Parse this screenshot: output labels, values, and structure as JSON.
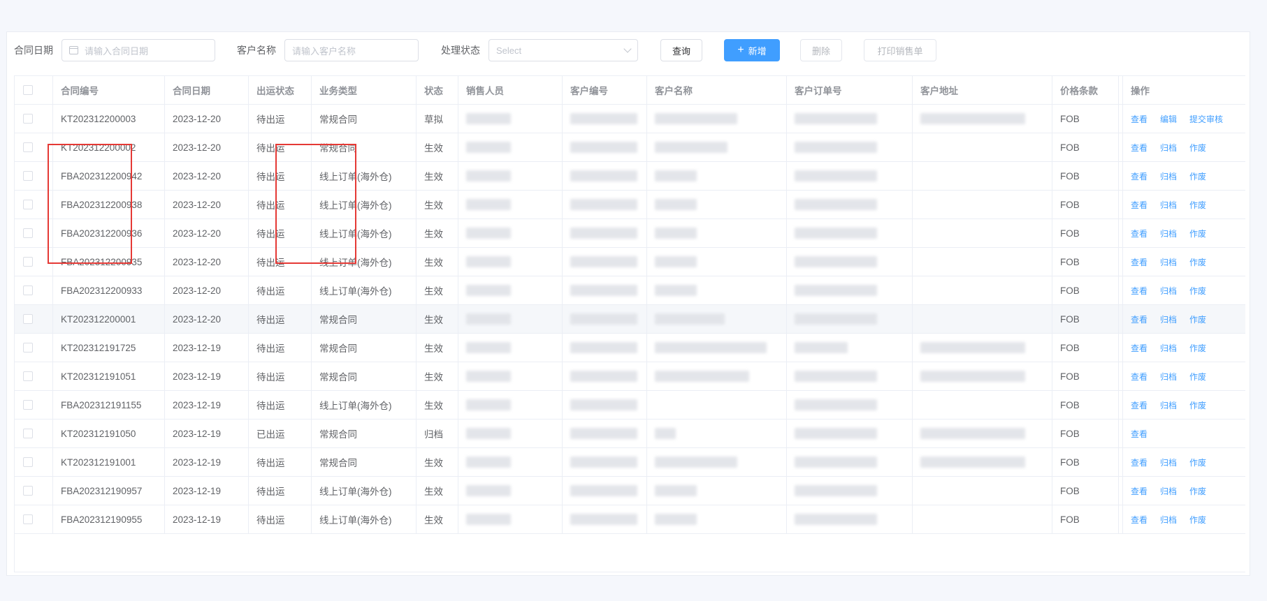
{
  "filters": {
    "contract_date_label": "合同日期",
    "contract_date_placeholder": "请输入合同日期",
    "customer_name_label": "客户名称",
    "customer_name_placeholder": "请输入客户名称",
    "status_label": "处理状态",
    "status_placeholder": "Select"
  },
  "toolbar": {
    "query": "查询",
    "add": "新增",
    "delete": "删除",
    "print_sales": "打印销售单"
  },
  "columns": [
    "合同编号",
    "合同日期",
    "出运状态",
    "业务类型",
    "状态",
    "销售人员",
    "客户编号",
    "客户名称",
    "客户订单号",
    "客户地址",
    "价格条款",
    "操作"
  ],
  "rows": [
    {
      "no": "KT202312200003",
      "date": "2023-12-20",
      "ship": "待出运",
      "type": "常规合同",
      "status": "草拟",
      "price": "FOB",
      "ops": [
        "查看",
        "编辑",
        "提交审核"
      ]
    },
    {
      "no": "KT202312200002",
      "date": "2023-12-20",
      "ship": "待出运",
      "type": "常规合同",
      "status": "生效",
      "price": "FOB",
      "ops": [
        "查看",
        "归档",
        "作废"
      ]
    },
    {
      "no": "FBA202312200942",
      "date": "2023-12-20",
      "ship": "待出运",
      "type": "线上订单(海外仓)",
      "status": "生效",
      "price": "FOB",
      "ops": [
        "查看",
        "归档",
        "作废"
      ]
    },
    {
      "no": "FBA202312200938",
      "date": "2023-12-20",
      "ship": "待出运",
      "type": "线上订单(海外仓)",
      "status": "生效",
      "price": "FOB",
      "ops": [
        "查看",
        "归档",
        "作废"
      ]
    },
    {
      "no": "FBA202312200936",
      "date": "2023-12-20",
      "ship": "待出运",
      "type": "线上订单(海外仓)",
      "status": "生效",
      "price": "FOB",
      "ops": [
        "查看",
        "归档",
        "作废"
      ]
    },
    {
      "no": "FBA202312200935",
      "date": "2023-12-20",
      "ship": "待出运",
      "type": "线上订单(海外仓)",
      "status": "生效",
      "price": "FOB",
      "ops": [
        "查看",
        "归档",
        "作废"
      ]
    },
    {
      "no": "FBA202312200933",
      "date": "2023-12-20",
      "ship": "待出运",
      "type": "线上订单(海外仓)",
      "status": "生效",
      "price": "FOB",
      "ops": [
        "查看",
        "归档",
        "作废"
      ]
    },
    {
      "no": "KT202312200001",
      "date": "2023-12-20",
      "ship": "待出运",
      "type": "常规合同",
      "status": "生效",
      "price": "FOB",
      "ops": [
        "查看",
        "归档",
        "作废"
      ]
    },
    {
      "no": "KT202312191725",
      "date": "2023-12-19",
      "ship": "待出运",
      "type": "常规合同",
      "status": "生效",
      "price": "FOB",
      "ops": [
        "查看",
        "归档",
        "作废"
      ]
    },
    {
      "no": "KT202312191051",
      "date": "2023-12-19",
      "ship": "待出运",
      "type": "常规合同",
      "status": "生效",
      "price": "FOB",
      "ops": [
        "查看",
        "归档",
        "作废"
      ]
    },
    {
      "no": "FBA202312191155",
      "date": "2023-12-19",
      "ship": "待出运",
      "type": "线上订单(海外仓)",
      "status": "生效",
      "price": "FOB",
      "ops": [
        "查看",
        "归档",
        "作废"
      ]
    },
    {
      "no": "KT202312191050",
      "date": "2023-12-19",
      "ship": "已出运",
      "type": "常规合同",
      "status": "归档",
      "price": "FOB",
      "ops": [
        "查看"
      ]
    },
    {
      "no": "KT202312191001",
      "date": "2023-12-19",
      "ship": "待出运",
      "type": "常规合同",
      "status": "生效",
      "price": "FOB",
      "ops": [
        "查看",
        "归档",
        "作废"
      ]
    },
    {
      "no": "FBA202312190957",
      "date": "2023-12-19",
      "ship": "待出运",
      "type": "线上订单(海外仓)",
      "status": "生效",
      "price": "FOB",
      "ops": [
        "查看",
        "归档",
        "作废"
      ]
    },
    {
      "no": "FBA202312190955",
      "date": "2023-12-19",
      "ship": "待出运",
      "type": "线上订单(海外仓)",
      "status": "生效",
      "price": "FOB",
      "ops": [
        "查看",
        "归档",
        "作废"
      ]
    }
  ],
  "highlight_color": "#e53935",
  "accent_color": "#409eff"
}
